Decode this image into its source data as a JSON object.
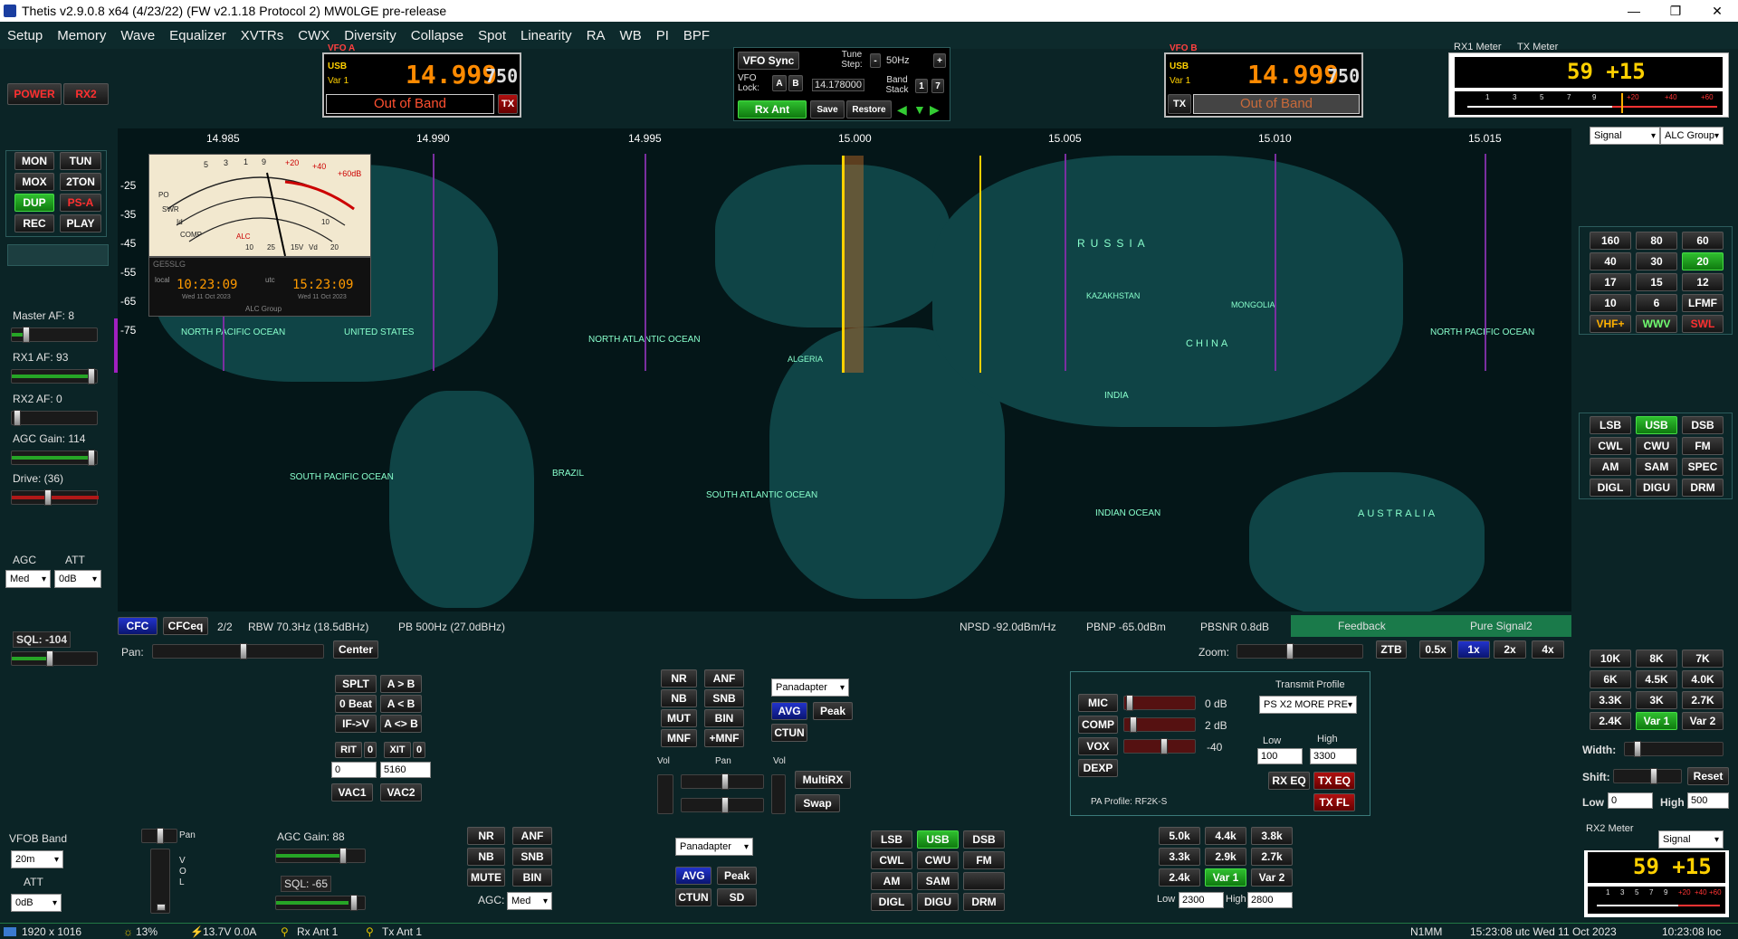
{
  "title": "Thetis v2.9.0.8 x64 (4/23/22) (FW v2.1.18 Protocol 2) MW0LGE pre-release",
  "window_controls": [
    "—",
    "❐",
    "✕"
  ],
  "menu": [
    "Setup",
    "Memory",
    "Wave",
    "Equalizer",
    "XVTRs",
    "CWX",
    "Diversity",
    "Collapse",
    "Spot",
    "Linearity",
    "RA",
    "WB",
    "PI",
    "BPF"
  ],
  "power": {
    "power": "POWER",
    "rx2": "RX2"
  },
  "vfoa": {
    "label": "VFO A",
    "mode": "USB",
    "var": "Var 1",
    "freq": "14.999",
    "sub": "750",
    "band_status": "Out of Band",
    "tx": "TX"
  },
  "vfob": {
    "label": "VFO B",
    "mode": "USB",
    "var": "Var 1",
    "freq": "14.999",
    "sub": "750",
    "band_status": "Out of Band",
    "tx": "TX"
  },
  "vfo_center": {
    "sync": "VFO Sync",
    "lock_label": "VFO Lock:",
    "a": "A",
    "b": "B",
    "tune_step_label": "Tune Step:",
    "minus": "-",
    "plus": "+",
    "tune_step": "50Hz",
    "freq_display": "14.178000",
    "band_stack_label": "Band Stack",
    "bs1": "1",
    "bs7": "7",
    "rx_ant": "Rx Ant",
    "save": "Save",
    "restore": "Restore"
  },
  "rx1meter": {
    "label1": "RX1 Meter",
    "label2": "TX Meter",
    "reading": "59 +15",
    "scale": [
      "1",
      "3",
      "5",
      "7",
      "9",
      "+20",
      "+40",
      "+60"
    ],
    "sel1": "Signal",
    "sel2": "ALC Group"
  },
  "rx2meter": {
    "label": "RX2 Meter",
    "sel": "Signal",
    "reading": "59 +15",
    "scale": [
      "1",
      "3",
      "5",
      "7",
      "9",
      "+20",
      "+40",
      "+60"
    ]
  },
  "left_buttons": [
    [
      "MON",
      "TUN"
    ],
    [
      "MOX",
      "2TON"
    ],
    [
      "DUP",
      "PS-A"
    ],
    [
      "REC",
      "PLAY"
    ]
  ],
  "left_controls": {
    "master_af": "Master AF:  8",
    "rx1_af": "RX1 AF:  93",
    "rx2_af": "RX2 AF:  0",
    "agc_gain": "AGC Gain:  114",
    "drive": "Drive:  (36)",
    "agc": "AGC",
    "att": "ATT",
    "agc_val": "Med",
    "att_val": "0dB",
    "sql": "SQL:  -104"
  },
  "freq_scale": [
    "14.985",
    "14.990",
    "14.995",
    "15.000",
    "15.005",
    "15.010",
    "15.015"
  ],
  "db_scale": [
    "-25",
    "-35",
    "-45",
    "-55",
    "-65",
    "-75"
  ],
  "spectrum_meter": {
    "local_label": "local",
    "utc_label": "utc",
    "local_time": "10:23:09",
    "utc_time": "15:23:09",
    "local_date": "Wed 11 Oct 2023",
    "utc_date": "Wed 11 Oct 2023",
    "alc_group": "ALC Group",
    "callsign": "GE5SLG",
    "a_scale": [
      "5",
      "3",
      "1",
      "9",
      "+20",
      "+40",
      "+60dB"
    ],
    "labels": [
      "PO",
      "SWR",
      "Id",
      "COMP",
      "ALC",
      "Vd",
      "15V",
      "25",
      "10",
      "20",
      "10"
    ]
  },
  "map_labels": [
    "NORTH PACIFIC OCEAN",
    "UNITED STATES",
    "NORTH ATLANTIC OCEAN",
    "SOUTH PACIFIC OCEAN",
    "BRAZIL",
    "SOUTH ATLANTIC OCEAN",
    "RUSSIA",
    "CHINA",
    "INDIA",
    "AUSTRALIA",
    "INDIAN OCEAN",
    "NORTH PACIFIC OCEAN",
    "MONGOLIA",
    "KAZAKHSTAN",
    "ALGERIA"
  ],
  "spectrum_status": {
    "cfc": "CFC",
    "cfceq": "CFCeq",
    "page": "2/2",
    "rbw": "RBW 70.3Hz (18.5dBHz)",
    "pb": "PB 500Hz (27.0dBHz)",
    "npsd": "NPSD -92.0dBm/Hz",
    "pbnp": "PBNP -65.0dBm",
    "pbsnr": "PBSNR 0.8dB",
    "feedback": "Feedback",
    "pure_signal": "Pure Signal2"
  },
  "pan_row": {
    "pan": "Pan:",
    "center": "Center",
    "zoom": "Zoom:",
    "ztb": "ZTB",
    "z05": "0.5x",
    "z1": "1x",
    "z2": "2x",
    "z4": "4x"
  },
  "bands": [
    [
      "160",
      "80",
      "60"
    ],
    [
      "40",
      "30",
      "20"
    ],
    [
      "17",
      "15",
      "12"
    ],
    [
      "10",
      "6",
      "LFMF"
    ],
    [
      "VHF+",
      "WWV",
      "SWL"
    ]
  ],
  "modes": [
    [
      "LSB",
      "USB",
      "DSB"
    ],
    [
      "CWL",
      "CWU",
      "FM"
    ],
    [
      "AM",
      "SAM",
      "SPEC"
    ],
    [
      "DIGL",
      "DIGU",
      "DRM"
    ]
  ],
  "filters": [
    [
      "10K",
      "8K",
      "7K"
    ],
    [
      "6K",
      "4.5K",
      "4.0K"
    ],
    [
      "3.3K",
      "3K",
      "2.7K"
    ],
    [
      "2.4K",
      "Var 1",
      "Var 2"
    ]
  ],
  "filter_controls": {
    "width": "Width:",
    "shift": "Shift:",
    "reset": "Reset",
    "low": "Low",
    "low_val": "0",
    "high": "High",
    "high_val": "500"
  },
  "split_block": {
    "splt": "SPLT",
    "atob": "A > B",
    "zerobeat": "0 Beat",
    "altb": "A < B",
    "ifv": "IF->V",
    "aswapb": "A <> B",
    "rit": "RIT",
    "rit_val": "0",
    "xit": "XIT",
    "xit_val": "0",
    "rit_spin": "0",
    "xit_spin": "5160",
    "vac1": "VAC1",
    "vac2": "VAC2"
  },
  "dsp_block": {
    "nr": "NR",
    "anf": "ANF",
    "nb": "NB",
    "snb": "SNB",
    "mut": "MUT",
    "bin": "BIN",
    "mnf": "MNF",
    "pmnf": "+MNF",
    "panadapter": "Panadapter",
    "avg": "AVG",
    "peak": "Peak",
    "ctun": "CTUN",
    "vol": "Vol",
    "pan": "Pan",
    "vol2": "Vol",
    "multirx": "MultiRX",
    "swap": "Swap"
  },
  "tx_block": {
    "mic": "MIC",
    "mic_val": "0 dB",
    "comp": "COMP",
    "comp_val": "2 dB",
    "vox": "VOX",
    "vox_val": "-40",
    "dexp": "DEXP",
    "profile_label": "Transmit Profile",
    "profile": "PS X2 MORE PRE",
    "low": "Low",
    "high": "High",
    "low_val": "100",
    "high_val": "3300",
    "rxeq": "RX EQ",
    "txeq": "TX EQ",
    "txfl": "TX FL",
    "pa_profile": "PA Profile:  RF2K-S"
  },
  "rx2_block": {
    "vfob_band": "VFOB Band",
    "band": "20m",
    "att": "ATT",
    "att_val": "0dB",
    "pan": "Pan",
    "vol": "VOL",
    "agc_gain": "AGC Gain:  88",
    "sql": "SQL:  -65",
    "nr": "NR",
    "anf": "ANF",
    "nb": "NB",
    "snb": "SNB",
    "mute": "MUTE",
    "bin": "BIN",
    "agc": "AGC:",
    "agc_val": "Med",
    "panadapter": "Panadapter",
    "avg": "AVG",
    "peak": "Peak",
    "ctun": "CTUN",
    "sd": "SD"
  },
  "rx2_modes": [
    [
      "LSB",
      "USB",
      "DSB"
    ],
    [
      "CWL",
      "CWU",
      "FM"
    ],
    [
      "AM",
      "SAM",
      ""
    ],
    [
      "DIGL",
      "DIGU",
      "DRM"
    ]
  ],
  "rx2_filters": [
    [
      "5.0k",
      "4.4k",
      "3.8k"
    ],
    [
      "3.3k",
      "2.9k",
      "2.7k"
    ],
    [
      "2.4k",
      "Var 1",
      "Var 2"
    ]
  ],
  "rx2_filter_ctrl": {
    "low": "Low",
    "low_val": "2300",
    "high": "High",
    "high_val": "2800"
  },
  "status": {
    "res": "1920 x 1016",
    "cpu": "13%",
    "volt": "13.7V  0.0A",
    "rxant": "Rx Ant 1",
    "txant": "Tx Ant 1",
    "n1mm": "N1MM",
    "utc": "15:23:08 utc  Wed 11 Oct 2023",
    "loc": "10:23:08 loc"
  },
  "colors": {
    "accent_green": "#26a526",
    "vfo_orange": "#ff8a00",
    "status_red": "#ff3030",
    "background": "#0b2426"
  }
}
